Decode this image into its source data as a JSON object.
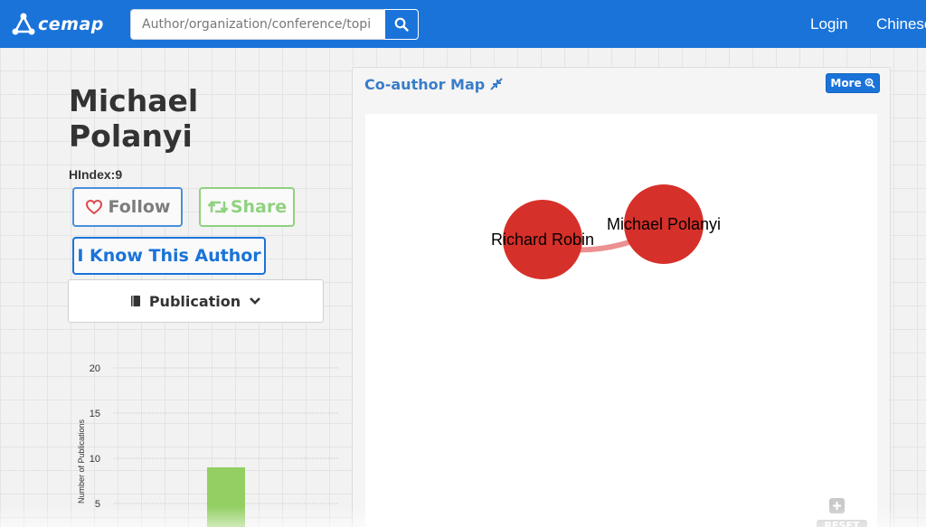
{
  "header": {
    "logo_text": "cemap",
    "search": {
      "placeholder": "Author/organization/conference/topi",
      "value": ""
    },
    "search_icon": "search-icon",
    "nav": {
      "login": "Login",
      "language": "Chinese"
    },
    "accent_color": "#1a73d9"
  },
  "author": {
    "name": "Michael Polanyi",
    "hindex_label": "HIndex:",
    "hindex_value": "9"
  },
  "actions": {
    "follow_label": "Follow",
    "follow_icon": "heart-icon",
    "share_label": "Share",
    "share_icon": "retweet-icon",
    "know_label": "I Know This Author",
    "publication_label": "Publication",
    "publication_icon": "book-icon",
    "dropdown_icon": "chevron-down-icon"
  },
  "chart_data": {
    "type": "bar",
    "ylabel": "Number of Publications",
    "yticks": [
      20,
      15,
      10,
      5
    ],
    "ylim": [
      0,
      20
    ],
    "grid": true,
    "categories": [
      ""
    ],
    "values": [
      9
    ],
    "bar_color": "#93cf62"
  },
  "coauthor_map": {
    "title": "Co-author Map",
    "title_icon": "compress-icon",
    "more_label": "More",
    "more_icon": "zoom-in-icon",
    "nodes": [
      {
        "label": "Richard Robin",
        "color": "#d6302a"
      },
      {
        "label": "Michael Polanyi",
        "color": "#d6302a"
      }
    ],
    "zoom_label": "+",
    "reset_label": "RESET"
  }
}
